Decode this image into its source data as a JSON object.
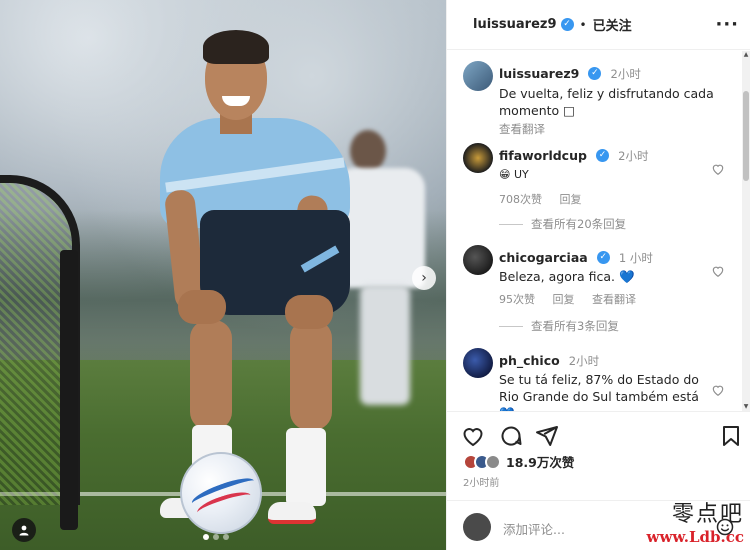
{
  "post": {
    "author": "luissuarez9",
    "follow_state": "已关注",
    "more": "···",
    "caption_time": "2小时",
    "caption_text": "De vuelta, feliz y disfrutando cada momento □",
    "caption_translate": "查看翻译",
    "next_arrow": "›"
  },
  "comments": [
    {
      "user": "fifaworldcup",
      "verified": true,
      "time": "2小时",
      "text": "UY",
      "emoji": "😁",
      "likes": "708次赞",
      "reply": "回复",
      "view_replies": "查看所有20条回复"
    },
    {
      "user": "chicogarciaa",
      "verified": true,
      "time": "1 小时",
      "text": "Beleza, agora fica.",
      "heart": "💙",
      "likes": "95次赞",
      "reply": "回复",
      "translate": "查看翻译",
      "view_replies": "查看所有3条回复"
    },
    {
      "user": "ph_chico",
      "verified": false,
      "time": "2小时",
      "text": "Se tu tá feliz, 87% do Estado do Rio Grande do Sul também está",
      "heart": "💙"
    }
  ],
  "footer": {
    "likes_count": "18.9万次赞",
    "time_ago": "2小时前",
    "comment_placeholder": "添加评论..."
  },
  "watermark": {
    "cn": "零点吧",
    "url": "www.Ldb.cc"
  },
  "colors": {
    "verified": "#3897f0",
    "muted": "#8e8e8e",
    "text": "#262626"
  }
}
